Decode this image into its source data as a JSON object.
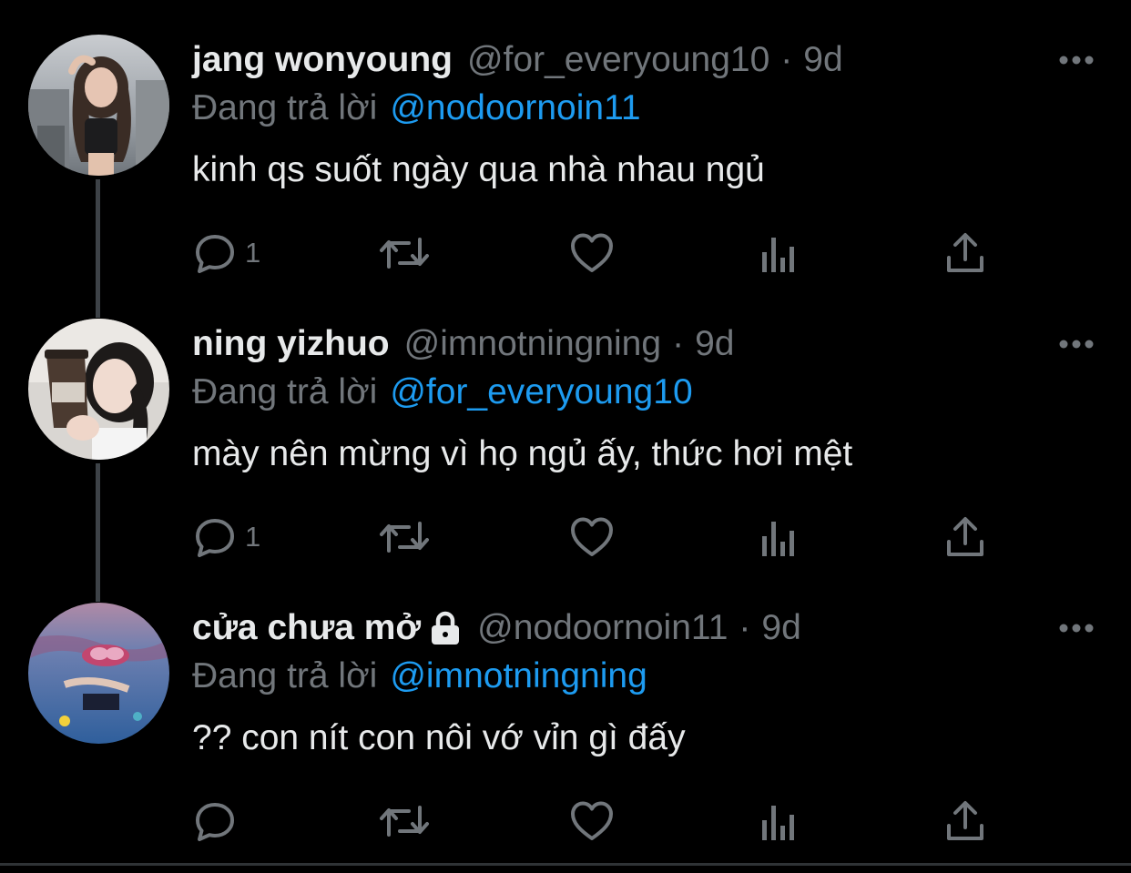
{
  "tweets": [
    {
      "display_name": "jang wonyoung",
      "handle": "@for_everyoung10",
      "separator": "·",
      "time": "9d",
      "replying_label": "Đang trả lời",
      "replying_to": "@nodoornoin11",
      "text": "kinh qs suốt ngày qua nhà nhau ngủ",
      "reply_count": "1",
      "protected": false
    },
    {
      "display_name": "ning yizhuo",
      "handle": "@imnotningning",
      "separator": "·",
      "time": "9d",
      "replying_label": "Đang trả lời",
      "replying_to": "@for_everyoung10",
      "text": "mày nên mừng vì họ ngủ ấy, thức hơi mệt",
      "reply_count": "1",
      "protected": false
    },
    {
      "display_name": "cửa chưa mở",
      "handle": "@nodoornoin11",
      "separator": "·",
      "time": "9d",
      "replying_label": "Đang trả lời",
      "replying_to": "@imnotningning",
      "text": "?? con nít con nôi vớ vỉn gì đấy",
      "reply_count": "",
      "protected": true
    }
  ],
  "icons": {
    "reply": "reply-icon",
    "retweet": "retweet-icon",
    "like": "heart-icon",
    "views": "views-icon",
    "share": "share-icon",
    "more": "more-icon",
    "lock": "lock-icon"
  },
  "colors": {
    "background": "#000000",
    "text": "#e7e9ea",
    "muted": "#71767b",
    "link": "#1d9bf0",
    "thread_line": "#3d4247"
  }
}
